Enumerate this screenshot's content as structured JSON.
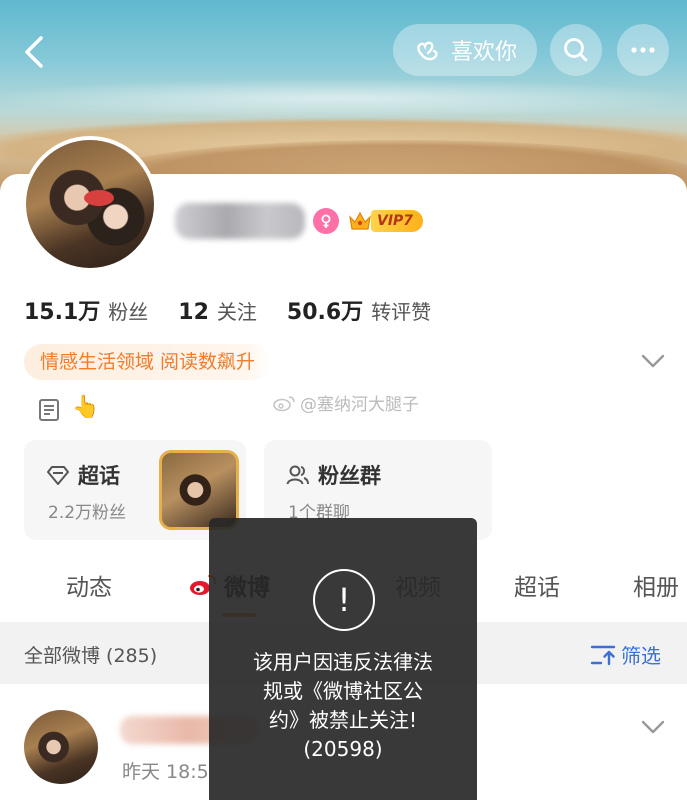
{
  "header": {
    "like_label": "喜欢你"
  },
  "profile": {
    "stats": [
      {
        "value": "15.1万",
        "label": "粉丝"
      },
      {
        "value": "12",
        "label": "关注"
      },
      {
        "value": "50.6万",
        "label": "转评赞"
      }
    ],
    "vip_label": "VIP7",
    "tag": "情感生活领域 阅读数飙升",
    "watermark": "@塞纳河大腿子"
  },
  "boxes": {
    "super": {
      "title": "超话",
      "sub": "2.2万粉丝"
    },
    "fans": {
      "title": "粉丝群",
      "sub": "1个群聊"
    }
  },
  "tabs": [
    {
      "label": "动态"
    },
    {
      "label": "微博"
    },
    {
      "label": "视频"
    },
    {
      "label": "超话"
    },
    {
      "label": "相册"
    }
  ],
  "filter": {
    "left": "全部微博 (285)",
    "right": "筛选"
  },
  "post": {
    "time": "昨天 18:5"
  },
  "toast": {
    "icon": "!",
    "message": "该用户因违反法律法\n规或《微博社区公\n约》被禁止关注!\n(20598)"
  },
  "colors": {
    "accent": "#f27c2a",
    "link": "#3d6fd6",
    "toast_bg": "#282828"
  }
}
